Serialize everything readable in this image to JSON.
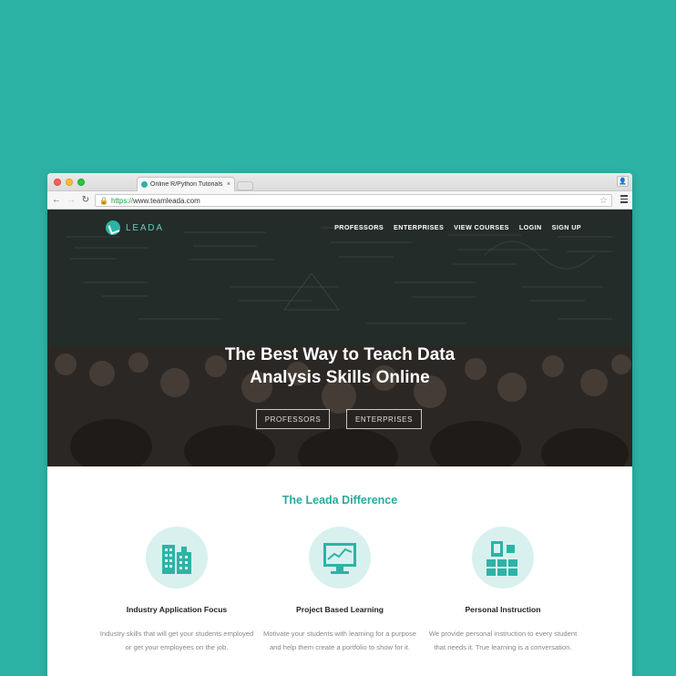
{
  "browser": {
    "tab_title": "Online R/Python Tutorials and",
    "tab_close": "×",
    "url_secure": "https://",
    "url_rest": "www.teamleada.com"
  },
  "site": {
    "logo_text": "LEADA",
    "nav": [
      "PROFESSORS",
      "ENTERPRISES",
      "VIEW COURSES",
      "LOGIN",
      "SIGN UP"
    ],
    "hero_title_line1": "The Best Way to Teach Data",
    "hero_title_line2": "Analysis Skills Online",
    "hero_buttons": [
      "PROFESSORS",
      "ENTERPRISES"
    ]
  },
  "difference": {
    "title": "The Leada Difference",
    "features": [
      {
        "icon": "buildings-icon",
        "title": "Industry Application Focus",
        "desc": "Industry skills that will get your students employed or get your employees on the job."
      },
      {
        "icon": "monitor-chart-icon",
        "title": "Project Based Learning",
        "desc": "Motivate your students with learning for a purpose and help them create a portfolio to show for it."
      },
      {
        "icon": "blocks-icon",
        "title": "Personal Instruction",
        "desc": "We provide personal instruction to every student that needs it. True learning is a conversation."
      }
    ]
  },
  "colors": {
    "background": "#2db3a6",
    "accent": "#2aa99c",
    "icon_circle": "#d8f1ee",
    "icon": "#2db3a6"
  }
}
